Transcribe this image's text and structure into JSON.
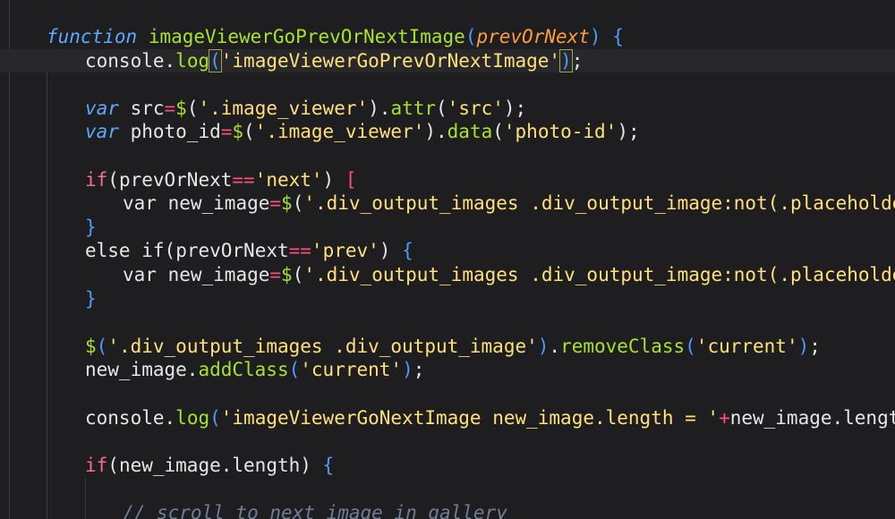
{
  "editor": {
    "lines": [
      {
        "id": "l1",
        "indent": 1,
        "tokens": [
          {
            "t": "function",
            "c": "tok-kw-fn"
          },
          {
            "t": " ",
            "c": "tok-plain"
          },
          {
            "t": "imageViewerGoPrevOrNextImage",
            "c": "tok-fnname"
          },
          {
            "t": "(",
            "c": "tok-paren"
          },
          {
            "t": "prevOrNext",
            "c": "tok-param"
          },
          {
            "t": ")",
            "c": "tok-paren"
          },
          {
            "t": " {",
            "c": "tok-brace"
          }
        ]
      },
      {
        "id": "l2",
        "indent": 2,
        "current": true,
        "tokens": [
          {
            "t": "console",
            "c": "tok-plain"
          },
          {
            "t": ".",
            "c": "tok-plain"
          },
          {
            "t": "log",
            "c": "tok-method"
          },
          {
            "t": "(",
            "c": "tok-paren tok-bracket-hl"
          },
          {
            "t": "'imageViewerGoPrevOrNextImage'",
            "c": "tok-string"
          },
          {
            "t": ")",
            "c": "tok-paren tok-bracket-hl"
          },
          {
            "t": ";",
            "c": "tok-plain"
          }
        ]
      },
      {
        "id": "l3",
        "indent": 0,
        "tokens": []
      },
      {
        "id": "l4",
        "indent": 2,
        "tokens": [
          {
            "t": "var",
            "c": "tok-kw-var"
          },
          {
            "t": " src",
            "c": "tok-plain"
          },
          {
            "t": "=",
            "c": "tok-op"
          },
          {
            "t": "$",
            "c": "tok-method"
          },
          {
            "t": "(",
            "c": "tok-plain"
          },
          {
            "t": "'.image_viewer'",
            "c": "tok-string"
          },
          {
            "t": ").",
            "c": "tok-plain"
          },
          {
            "t": "attr",
            "c": "tok-method"
          },
          {
            "t": "(",
            "c": "tok-plain"
          },
          {
            "t": "'src'",
            "c": "tok-string"
          },
          {
            "t": ");",
            "c": "tok-plain"
          }
        ]
      },
      {
        "id": "l5",
        "indent": 2,
        "tokens": [
          {
            "t": "var",
            "c": "tok-kw-var"
          },
          {
            "t": " photo_id",
            "c": "tok-plain"
          },
          {
            "t": "=",
            "c": "tok-op"
          },
          {
            "t": "$",
            "c": "tok-method"
          },
          {
            "t": "(",
            "c": "tok-plain"
          },
          {
            "t": "'.image_viewer'",
            "c": "tok-string"
          },
          {
            "t": ").",
            "c": "tok-plain"
          },
          {
            "t": "data",
            "c": "tok-method"
          },
          {
            "t": "(",
            "c": "tok-plain"
          },
          {
            "t": "'photo-id'",
            "c": "tok-string"
          },
          {
            "t": ");",
            "c": "tok-plain"
          }
        ]
      },
      {
        "id": "l6",
        "indent": 0,
        "tokens": []
      },
      {
        "id": "l7",
        "indent": 2,
        "tokens": [
          {
            "t": "if",
            "c": "tok-kw-if"
          },
          {
            "t": "(",
            "c": "tok-plain"
          },
          {
            "t": "prevOrNext",
            "c": "tok-plain"
          },
          {
            "t": "==",
            "c": "tok-op"
          },
          {
            "t": "'next'",
            "c": "tok-string"
          },
          {
            "t": ") ",
            "c": "tok-plain"
          },
          {
            "t": "[",
            "c": "tok-bracket-red"
          }
        ]
      },
      {
        "id": "l8",
        "indent": 3,
        "tokens": [
          {
            "t": "var",
            "c": "tok-plain"
          },
          {
            "t": " new_image",
            "c": "tok-plain"
          },
          {
            "t": "=",
            "c": "tok-op"
          },
          {
            "t": "$",
            "c": "tok-method"
          },
          {
            "t": "(",
            "c": "tok-plain"
          },
          {
            "t": "'.div_output_images .div_output_image:not(.placeholder)[data-phot",
            "c": "tok-string"
          }
        ]
      },
      {
        "id": "l9",
        "indent": 2,
        "tokens": [
          {
            "t": "}",
            "c": "tok-brace"
          }
        ]
      },
      {
        "id": "l10",
        "indent": 2,
        "tokens": [
          {
            "t": "else",
            "c": "tok-kw-else"
          },
          {
            "t": " ",
            "c": "tok-plain"
          },
          {
            "t": "if",
            "c": "tok-plain"
          },
          {
            "t": "(",
            "c": "tok-plain"
          },
          {
            "t": "prevOrNext",
            "c": "tok-plain"
          },
          {
            "t": "==",
            "c": "tok-op"
          },
          {
            "t": "'prev'",
            "c": "tok-string"
          },
          {
            "t": ") ",
            "c": "tok-plain"
          },
          {
            "t": "{",
            "c": "tok-brace"
          }
        ]
      },
      {
        "id": "l11",
        "indent": 3,
        "tokens": [
          {
            "t": "var",
            "c": "tok-plain"
          },
          {
            "t": " new_image",
            "c": "tok-plain"
          },
          {
            "t": "=",
            "c": "tok-op"
          },
          {
            "t": "$",
            "c": "tok-method"
          },
          {
            "t": "(",
            "c": "tok-plain"
          },
          {
            "t": "'.div_output_images .div_output_image:not(.placeholder)[data-phot",
            "c": "tok-string"
          }
        ]
      },
      {
        "id": "l12",
        "indent": 2,
        "tokens": [
          {
            "t": "}",
            "c": "tok-brace"
          }
        ]
      },
      {
        "id": "l13",
        "indent": 0,
        "tokens": []
      },
      {
        "id": "l14",
        "indent": 2,
        "tokens": [
          {
            "t": "$",
            "c": "tok-method"
          },
          {
            "t": "(",
            "c": "tok-paren"
          },
          {
            "t": "'.div_output_images .div_output_image'",
            "c": "tok-string"
          },
          {
            "t": ")",
            "c": "tok-paren"
          },
          {
            "t": ".",
            "c": "tok-plain"
          },
          {
            "t": "removeClass",
            "c": "tok-method"
          },
          {
            "t": "(",
            "c": "tok-paren"
          },
          {
            "t": "'current'",
            "c": "tok-string"
          },
          {
            "t": ")",
            "c": "tok-paren"
          },
          {
            "t": ";",
            "c": "tok-plain"
          }
        ]
      },
      {
        "id": "l15",
        "indent": 2,
        "tokens": [
          {
            "t": "new_image",
            "c": "tok-plain"
          },
          {
            "t": ".",
            "c": "tok-plain"
          },
          {
            "t": "addClass",
            "c": "tok-method"
          },
          {
            "t": "(",
            "c": "tok-paren"
          },
          {
            "t": "'current'",
            "c": "tok-string"
          },
          {
            "t": ")",
            "c": "tok-paren"
          },
          {
            "t": ";",
            "c": "tok-plain"
          }
        ]
      },
      {
        "id": "l16",
        "indent": 0,
        "tokens": []
      },
      {
        "id": "l17",
        "indent": 2,
        "tokens": [
          {
            "t": "console",
            "c": "tok-plain"
          },
          {
            "t": ".",
            "c": "tok-plain"
          },
          {
            "t": "log",
            "c": "tok-method"
          },
          {
            "t": "(",
            "c": "tok-paren"
          },
          {
            "t": "'imageViewerGoNextImage new_image.length = '",
            "c": "tok-string"
          },
          {
            "t": "+",
            "c": "tok-op"
          },
          {
            "t": "new_image.length",
            "c": "tok-plain"
          },
          {
            "t": ")",
            "c": "tok-paren"
          },
          {
            "t": ";",
            "c": "tok-plain"
          }
        ]
      },
      {
        "id": "l18",
        "indent": 0,
        "tokens": []
      },
      {
        "id": "l19",
        "indent": 2,
        "tokens": [
          {
            "t": "if",
            "c": "tok-kw-if"
          },
          {
            "t": "(",
            "c": "tok-plain"
          },
          {
            "t": "new_image.length",
            "c": "tok-plain"
          },
          {
            "t": ") ",
            "c": "tok-plain"
          },
          {
            "t": "{",
            "c": "tok-brace"
          }
        ]
      },
      {
        "id": "l20",
        "indent": 0,
        "tokens": []
      },
      {
        "id": "l21",
        "indent": 3,
        "tokens": [
          {
            "t": "// scroll to next image in gallery",
            "c": "tok-comment"
          }
        ]
      }
    ]
  }
}
